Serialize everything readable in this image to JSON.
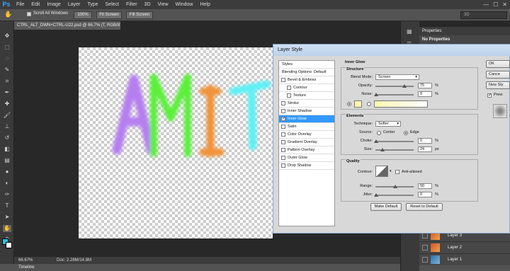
{
  "app": {
    "logo": "Ps"
  },
  "menubar": {
    "items": [
      "File",
      "Edit",
      "Image",
      "Layer",
      "Type",
      "Select",
      "Filter",
      "3D",
      "View",
      "Window",
      "Help"
    ],
    "win_controls": [
      "—",
      "☐",
      "✕"
    ]
  },
  "options": {
    "scroll_all_label": "Scroll All Windows",
    "zoom_100": "100%",
    "fit_screen": "Fit Screen",
    "fill_screen": "Fill Screen",
    "workspace": "3D"
  },
  "document": {
    "tab_title": "CTRL_ALT_DWN+CTRL-U22.psd @ 66.7% (T, RGB/8) *"
  },
  "status": {
    "zoom": "66.67%",
    "doc_size": "Doc: 2.28M/14.8M"
  },
  "timeline": {
    "label": "Timeline"
  },
  "canvas_text": {
    "letters": [
      "A",
      "M",
      "I",
      "T"
    ],
    "colors": [
      "#b57ff0",
      "#5cf03a",
      "#f0933a",
      "#5ff0f5"
    ]
  },
  "properties": {
    "title": "Properties",
    "subtitle": "No Properties"
  },
  "layers": [
    {
      "name": "Layer 3"
    },
    {
      "name": "Layer 2"
    },
    {
      "name": "Layer 1"
    }
  ],
  "dialog": {
    "title": "Layer Style",
    "styles_header": "Styles",
    "blending_options": "Blending Options: Default",
    "effects": [
      {
        "label": "Bevel & Emboss",
        "checked": false
      },
      {
        "label": "Contour",
        "checked": false
      },
      {
        "label": "Texture",
        "checked": false
      },
      {
        "label": "Stroke",
        "checked": false
      },
      {
        "label": "Inner Shadow",
        "checked": false
      },
      {
        "label": "Inner Glow",
        "checked": true
      },
      {
        "label": "Satin",
        "checked": false
      },
      {
        "label": "Color Overlay",
        "checked": false
      },
      {
        "label": "Gradient Overlay",
        "checked": false
      },
      {
        "label": "Pattern Overlay",
        "checked": false
      },
      {
        "label": "Outer Glow",
        "checked": false
      },
      {
        "label": "Drop Shadow",
        "checked": false
      }
    ],
    "section_title": "Inner Glow",
    "structure": {
      "title": "Structure",
      "blend_mode_label": "Blend Mode:",
      "blend_mode": "Screen",
      "opacity_label": "Opacity:",
      "opacity": "75",
      "noise_label": "Noise:",
      "noise": "0",
      "pct": "%",
      "glow_color": "#fdf7b2"
    },
    "elements": {
      "title": "Elements",
      "technique_label": "Technique:",
      "technique": "Softer",
      "source_label": "Source:",
      "center": "Center",
      "edge": "Edge",
      "choke_label": "Choke:",
      "choke": "0",
      "size_label": "Size:",
      "size": "24",
      "px": "px"
    },
    "quality": {
      "title": "Quality",
      "contour_label": "Contour:",
      "anti_aliased": "Anti-aliased",
      "range_label": "Range:",
      "range": "50",
      "jitter_label": "Jitter:",
      "jitter": "0"
    },
    "make_default": "Make Default",
    "reset_default": "Reset to Default",
    "ok": "OK",
    "cancel": "Cance",
    "new_style": "New Sty",
    "preview": "Previ"
  }
}
